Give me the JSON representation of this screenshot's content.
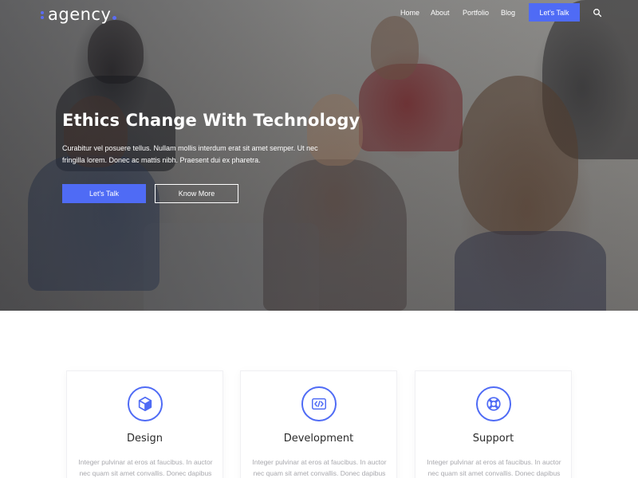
{
  "brand": {
    "name": "agency",
    "accent": "#4f6bf5"
  },
  "nav": {
    "items": [
      {
        "label": "Home"
      },
      {
        "label": "About"
      },
      {
        "label": "Portfolio"
      },
      {
        "label": "Blog"
      }
    ],
    "cta_label": "Let's Talk",
    "search_icon": "search-icon"
  },
  "hero": {
    "title": "Ethics Change With Technology",
    "text": "Curabitur vel posuere tellus. Nullam mollis interdum erat sit amet semper. Ut nec fringilla lorem. Donec ac mattis nibh. Praesent dui ex pharetra.",
    "primary_button": "Let's Talk",
    "secondary_button": "Know More"
  },
  "services": [
    {
      "icon": "cube-icon",
      "title": "Design",
      "text": "Integer pulvinar at eros at faucibus. In auctor nec quam sit amet convallis. Donec dapibus nunc."
    },
    {
      "icon": "code-icon",
      "title": "Development",
      "text": "Integer pulvinar at eros at faucibus. In auctor nec quam sit amet convallis. Donec dapibus nunc."
    },
    {
      "icon": "lifebuoy-icon",
      "title": "Support",
      "text": "Integer pulvinar at eros at faucibus. In auctor nec quam sit amet convallis. Donec dapibus nunc."
    }
  ]
}
